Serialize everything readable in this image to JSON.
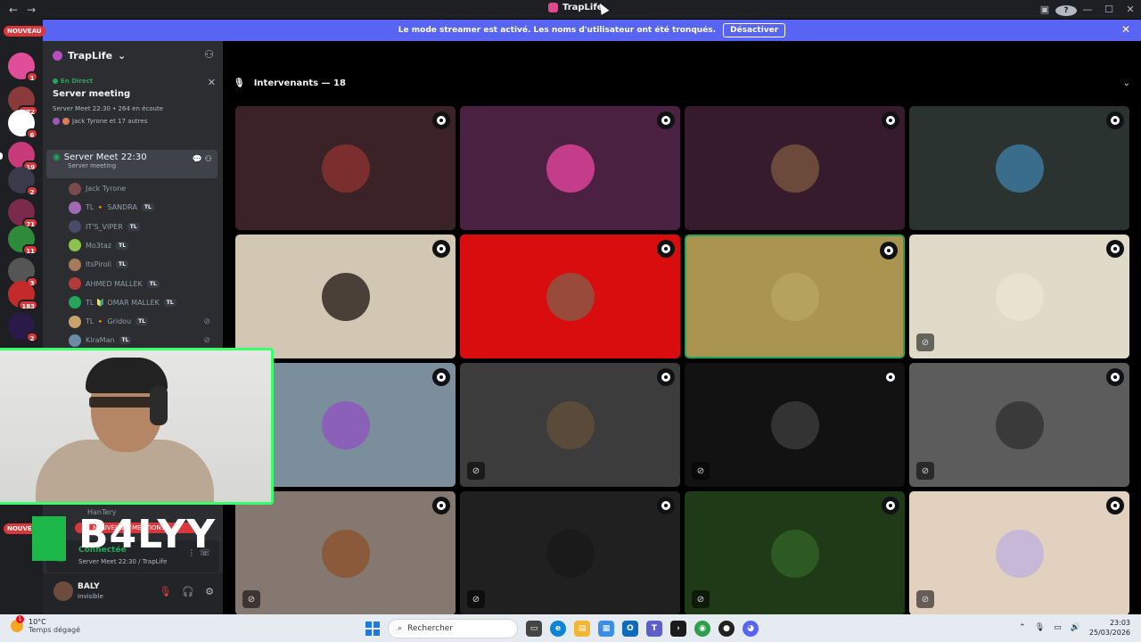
{
  "window": {
    "title": "TrapLife"
  },
  "banner": {
    "message": "Le mode streamer est activé. Les noms d'utilisateur ont été tronqués.",
    "button": "Désactiver"
  },
  "rail": {
    "nouveau_label": "NOUVEAU",
    "badges": [
      "1",
      "172",
      "6",
      "19",
      "2",
      "71",
      "11",
      "3",
      "183",
      "2"
    ]
  },
  "server": {
    "name": "TrapLife"
  },
  "live": {
    "tag": "En Direct",
    "title": "Server meeting",
    "meta": "Server Meet 22:30 • 264 en écoute",
    "people": "Jack Tyrone et 17 autres"
  },
  "channel": {
    "name": "Server Meet 22:30",
    "sub": "Server meeting"
  },
  "voice_users": [
    {
      "name": "Jack Tyrone",
      "badge": "",
      "color": "#7a4b4b",
      "muted": false
    },
    {
      "name": "TL 🔸 SANDRA",
      "badge": "TL",
      "color": "#a16ab5",
      "muted": false
    },
    {
      "name": "IT'S_VIPER",
      "badge": "TL",
      "color": "#4a4a6a",
      "muted": false
    },
    {
      "name": "Mo3taz",
      "badge": "TL",
      "color": "#8bc34a",
      "muted": false
    },
    {
      "name": "ItsPiroli",
      "badge": "TL",
      "color": "#a87a5a",
      "muted": false
    },
    {
      "name": "AHMED MALLEK",
      "badge": "TL",
      "color": "#b33a3a",
      "muted": false
    },
    {
      "name": "TL 🔰 OMAR MALLEK",
      "badge": "TL",
      "color": "#23a55a",
      "muted": false
    },
    {
      "name": "TL 🔸 Gridou",
      "badge": "TL",
      "color": "#c8a26a",
      "muted": true
    },
    {
      "name": "KiraMan",
      "badge": "TL",
      "color": "#6c8aa8",
      "muted": true
    }
  ],
  "hidden_user": {
    "name": "HanTery"
  },
  "mention_label": "NOUVELLES MENTIONS",
  "connection": {
    "state": "Connectée",
    "sub": "Server Meet 22:30 / TrapLife"
  },
  "user": {
    "name": "BALY",
    "status": "Invisible"
  },
  "stage": {
    "header": "Intervenants — 18",
    "tiles": [
      {
        "bg": "#3a2227",
        "av": "#7a2e2e",
        "muted": false,
        "speaking": false
      },
      {
        "bg": "#4a2140",
        "av": "#c43d8a",
        "muted": false,
        "speaking": false
      },
      {
        "bg": "#351b2c",
        "av": "#6b4a3c",
        "muted": false,
        "speaking": false
      },
      {
        "bg": "#2a3330",
        "av": "#3a6c8c",
        "muted": false,
        "speaking": false
      },
      {
        "bg": "#d2c7b3",
        "av": "#4a4038",
        "muted": false,
        "speaking": false
      },
      {
        "bg": "#d90d0d",
        "av": "#9a4a3a",
        "muted": false,
        "speaking": false
      },
      {
        "bg": "#a9954f",
        "av": "#b5a25f",
        "muted": false,
        "speaking": true
      },
      {
        "bg": "#e0dbc8",
        "av": "#e8e2d0",
        "muted": true,
        "speaking": false
      },
      {
        "bg": "#7b8e9c",
        "av": "#8a60b8",
        "muted": false,
        "speaking": false
      },
      {
        "bg": "#3c3c3c",
        "av": "#5a4a3a",
        "muted": true,
        "speaking": false
      },
      {
        "bg": "#121212",
        "av": "#333333",
        "muted": true,
        "speaking": false
      },
      {
        "bg": "#5c5c5c",
        "av": "#3a3a3a",
        "muted": true,
        "speaking": false
      },
      {
        "bg": "#857870",
        "av": "#8a5a3a",
        "muted": true,
        "speaking": false
      },
      {
        "bg": "#202020",
        "av": "#1a1a1a",
        "muted": true,
        "speaking": false
      },
      {
        "bg": "#1e3a16",
        "av": "#2d5a22",
        "muted": true,
        "speaking": false
      },
      {
        "bg": "#e3d1bf",
        "av": "#c7b8d8",
        "muted": true,
        "speaking": false
      }
    ]
  },
  "overlay": {
    "brand": "B4LYY"
  },
  "taskbar": {
    "temp": "10°C",
    "weather": "Temps dégagé",
    "weather_badge": "1",
    "search_placeholder": "Rechercher",
    "time": "23:03",
    "date": "25/03/2026"
  }
}
